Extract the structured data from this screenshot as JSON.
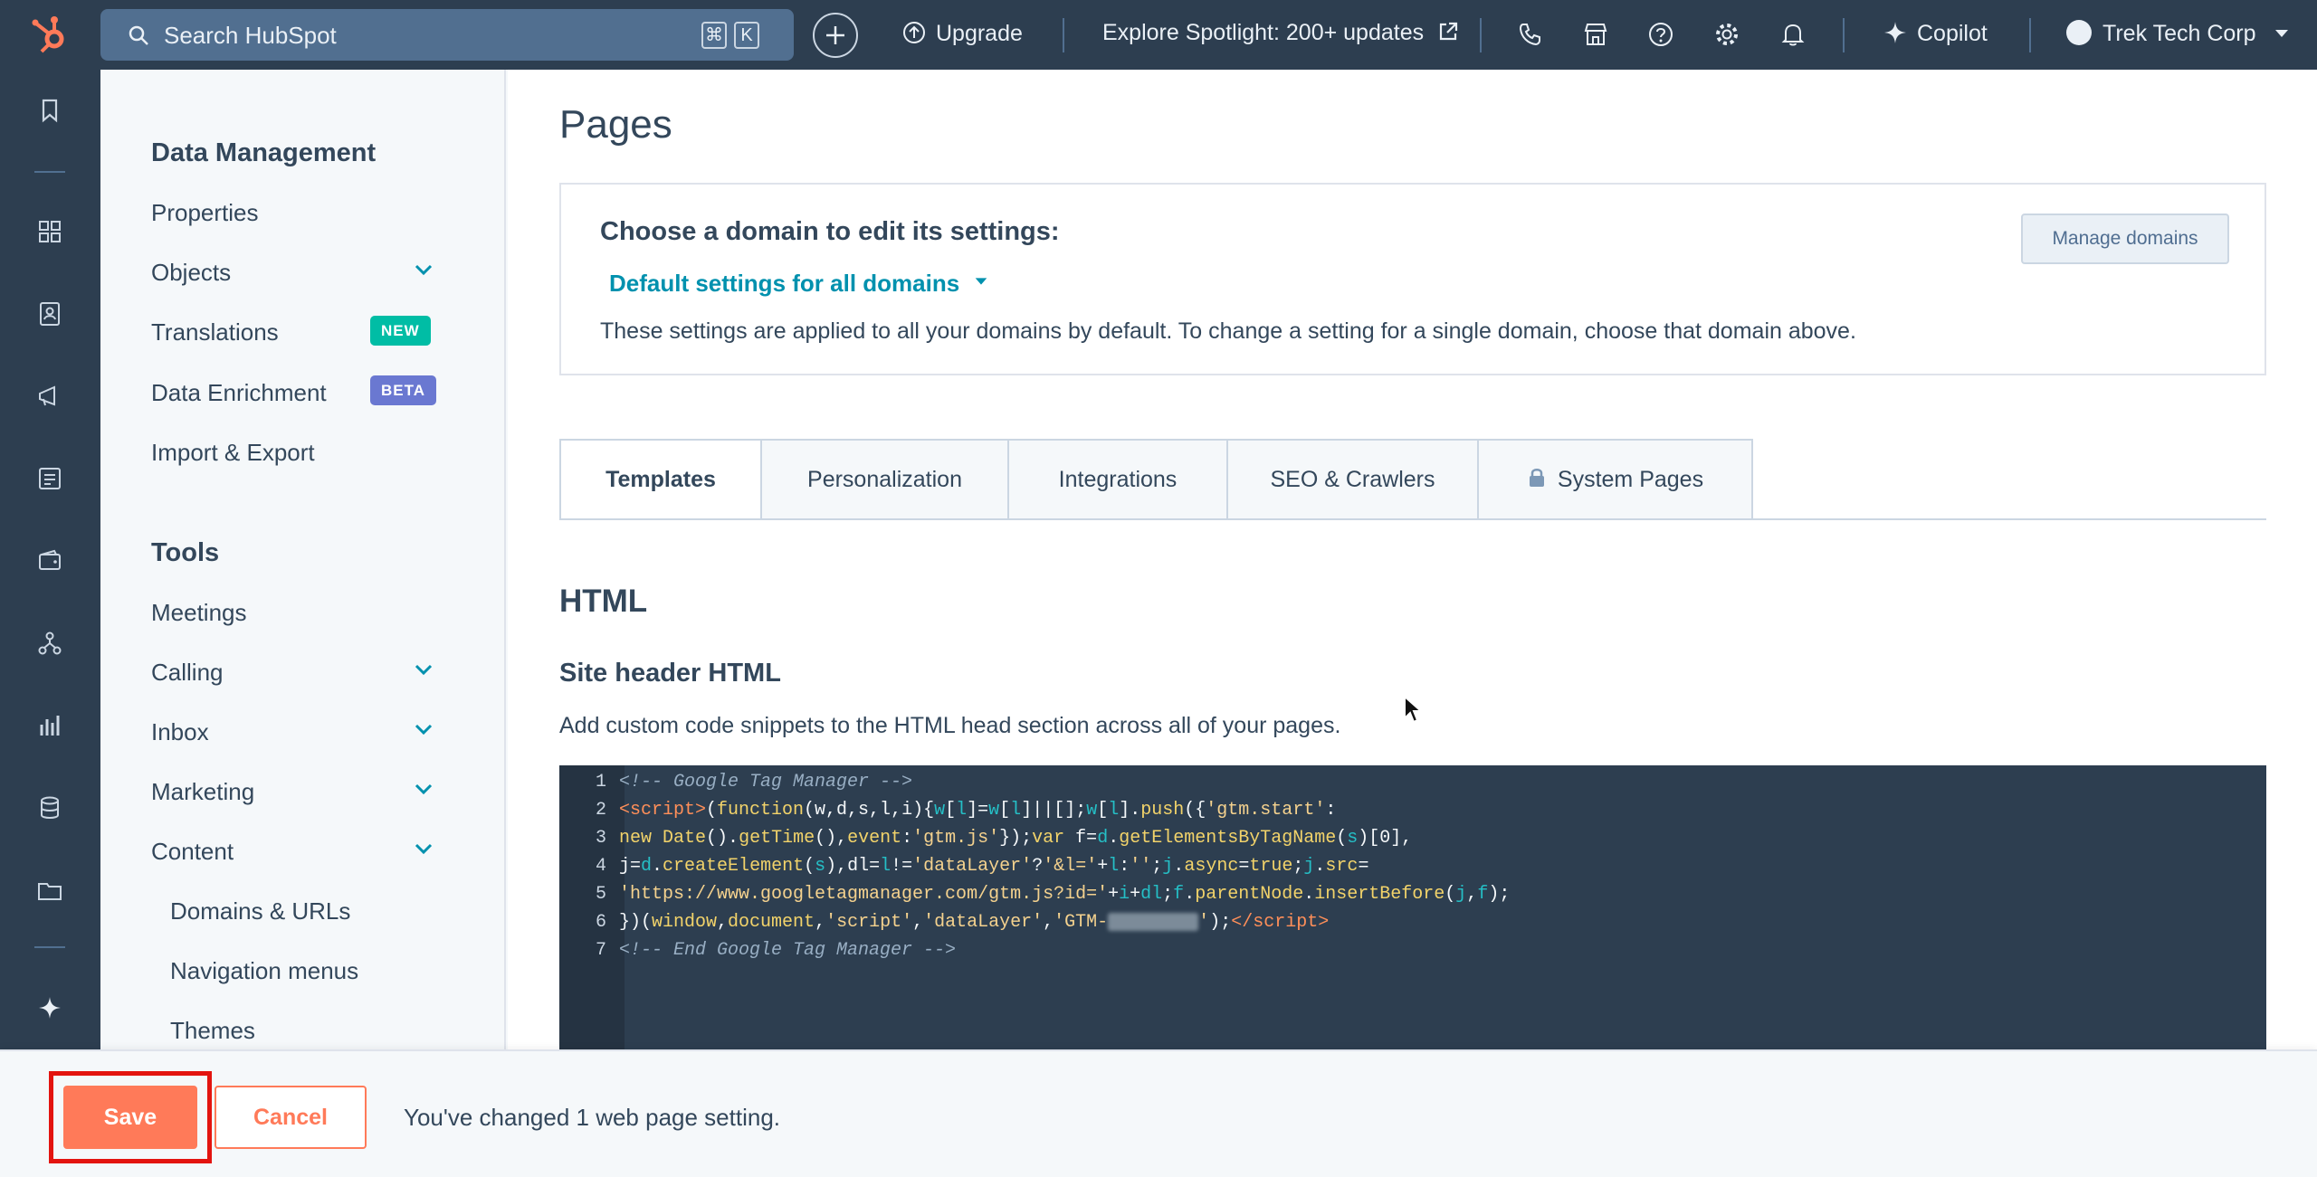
{
  "topbar": {
    "search_placeholder": "Search HubSpot",
    "kbd_cmd": "⌘",
    "kbd_k": "K",
    "upgrade": "Upgrade",
    "spotlight": "Explore Spotlight: 200+ updates",
    "copilot": "Copilot",
    "account": "Trek Tech Corp"
  },
  "sidebar": {
    "section1": "Data Management",
    "properties": "Properties",
    "objects": "Objects",
    "translations": "Translations",
    "translations_badge": "NEW",
    "data_enrichment": "Data Enrichment",
    "data_enrichment_badge": "BETA",
    "import_export": "Import & Export",
    "section2": "Tools",
    "meetings": "Meetings",
    "calling": "Calling",
    "inbox": "Inbox",
    "marketing": "Marketing",
    "content": "Content",
    "domains_urls": "Domains & URLs",
    "navigation_menus": "Navigation menus",
    "themes": "Themes"
  },
  "main": {
    "title": "Pages",
    "domain_heading": "Choose a domain to edit its settings:",
    "domain_selected": "Default settings for all domains",
    "domain_desc": "These settings are applied to all your domains by default. To change a setting for a single domain, choose that domain above.",
    "manage_domains": "Manage domains",
    "tabs": [
      "Templates",
      "Personalization",
      "Integrations",
      "SEO & Crawlers",
      "System Pages"
    ],
    "html_heading": "HTML",
    "site_header_heading": "Site header HTML",
    "site_header_desc": "Add custom code snippets to the HTML head section across all of your pages.",
    "code_line_numbers": [
      "1",
      "2",
      "3",
      "4",
      "5",
      "6",
      "7"
    ]
  },
  "footer": {
    "save": "Save",
    "cancel": "Cancel",
    "message": "You've changed 1 web page setting."
  },
  "colors": {
    "nav_bg": "#2d3e50",
    "accent": "#ff7a59",
    "link": "#0091ae",
    "badge_new": "#00bda5",
    "badge_beta": "#6a78d1",
    "highlight": "#e3140f"
  }
}
